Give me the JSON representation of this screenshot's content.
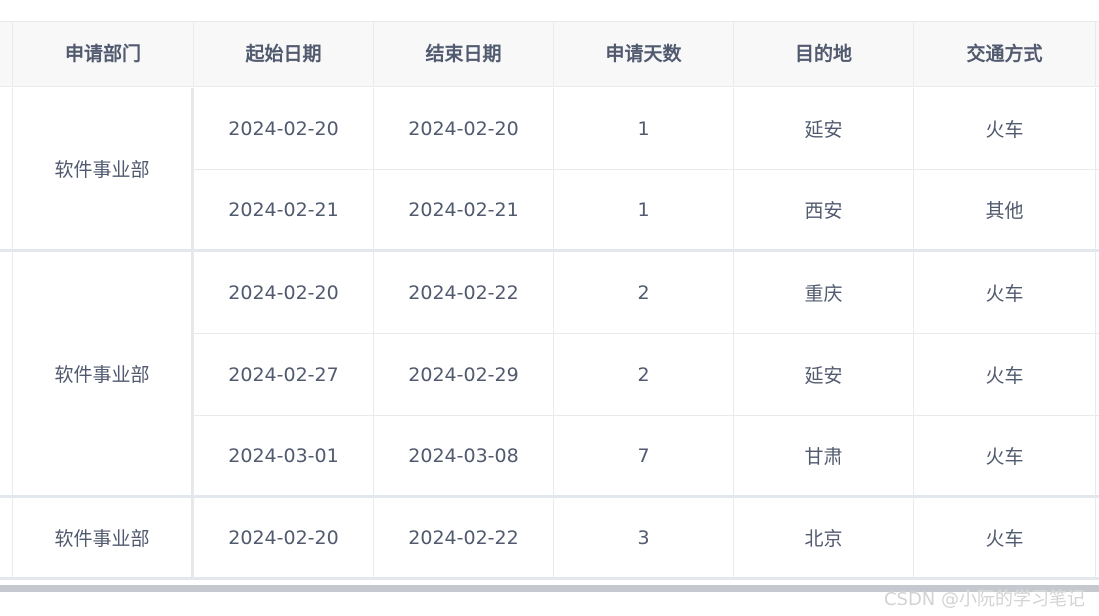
{
  "table": {
    "headers": [
      "申请部门",
      "起始日期",
      "结束日期",
      "申请天数",
      "目的地",
      "交通方式"
    ],
    "groups": [
      {
        "dept": "软件事业部",
        "rows": [
          [
            "2024-02-20",
            "2024-02-20",
            "1",
            "延安",
            "火车"
          ],
          [
            "2024-02-21",
            "2024-02-21",
            "1",
            "西安",
            "其他"
          ]
        ]
      },
      {
        "dept": "软件事业部",
        "rows": [
          [
            "2024-02-20",
            "2024-02-22",
            "2",
            "重庆",
            "火车"
          ],
          [
            "2024-02-27",
            "2024-02-29",
            "2",
            "延安",
            "火车"
          ],
          [
            "2024-03-01",
            "2024-03-08",
            "7",
            "甘肃",
            "火车"
          ]
        ]
      },
      {
        "dept": "软件事业部",
        "rows": [
          [
            "2024-02-20",
            "2024-02-22",
            "3",
            "北京",
            "火车"
          ]
        ]
      }
    ]
  },
  "watermark": "CSDN @小阮的学习笔记"
}
